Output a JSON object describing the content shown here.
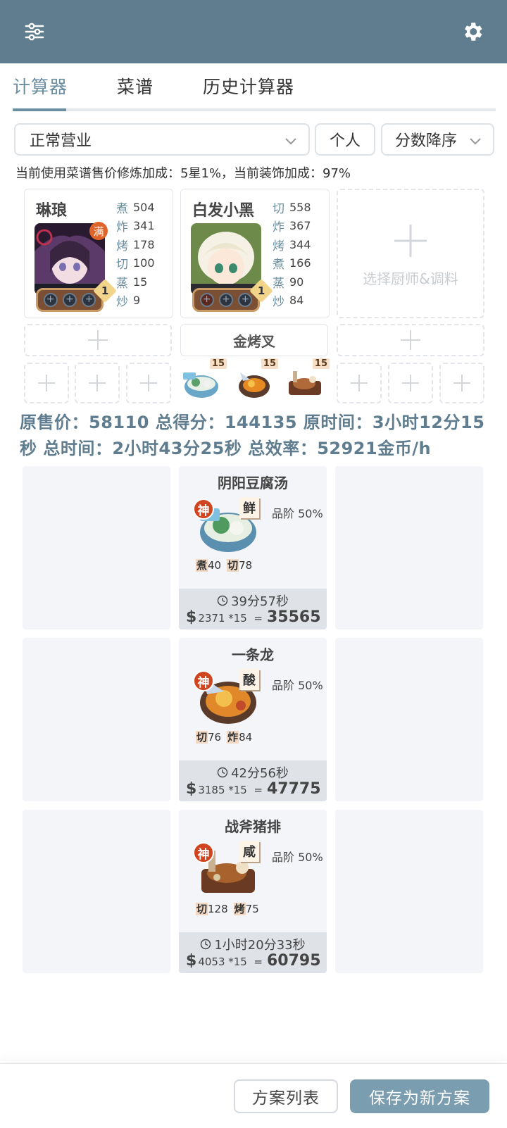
{
  "header": {
    "filter_icon": "sliders-icon",
    "settings_icon": "gear-icon",
    "accent_color": "#5f7d8f"
  },
  "tabs": [
    {
      "label": "计算器",
      "active": true
    },
    {
      "label": "菜谱"
    },
    {
      "label": "历史计算器"
    }
  ],
  "filters": {
    "mode": "正常营业",
    "scope": "个人",
    "sort": "分数降序"
  },
  "info_line": "当前使用菜谱售价修炼加成：5星1%，当前装饰加成：97%",
  "chefs": [
    {
      "name": "琳琅",
      "badge": "满",
      "level": "1",
      "stats": [
        {
          "k": "煮",
          "v": "504"
        },
        {
          "k": "炸",
          "v": "341"
        },
        {
          "k": "烤",
          "v": "178"
        },
        {
          "k": "切",
          "v": "100"
        },
        {
          "k": "蒸",
          "v": "15"
        },
        {
          "k": "炒",
          "v": "9"
        }
      ]
    },
    {
      "name": "白发小黑",
      "level": "1",
      "stats": [
        {
          "k": "切",
          "v": "558"
        },
        {
          "k": "炸",
          "v": "367"
        },
        {
          "k": "烤",
          "v": "344"
        },
        {
          "k": "煮",
          "v": "166"
        },
        {
          "k": "蒸",
          "v": "90"
        },
        {
          "k": "炒",
          "v": "84"
        }
      ]
    }
  ],
  "add_chef_label": "选择厨师&调料",
  "equipment": "金烤叉",
  "mini_recipe_counts": [
    "15",
    "15",
    "15"
  ],
  "summary": "原售价：58110 总得分：144135 原时间：3小时12分15秒 总时间：2小时43分25秒 总效率：52921金币/h",
  "recipes": [
    {
      "name": "阴阳豆腐汤",
      "badge": "神",
      "taste": "鲜",
      "grade": "品阶 50%",
      "req1_k": "煮",
      "req1_v": "40",
      "req2_k": "切",
      "req2_v": "78",
      "time": "39分57秒",
      "price": "2371 *15",
      "total": "35565"
    },
    {
      "name": "一条龙",
      "badge": "神",
      "taste": "酸",
      "grade": "品阶 50%",
      "req1_k": "切",
      "req1_v": "76",
      "req2_k": "炸",
      "req2_v": "84",
      "time": "42分56秒",
      "price": "3185 *15",
      "total": "47775"
    },
    {
      "name": "战斧猪排",
      "badge": "神",
      "taste": "咸",
      "grade": "品阶 50%",
      "req1_k": "切",
      "req1_v": "128",
      "req2_k": "烤",
      "req2_v": "75",
      "time": "1小时20分33秒",
      "price": "4053 *15",
      "total": "60795"
    }
  ],
  "currency_symbol": "$",
  "equals": "=",
  "buttons": {
    "plan_list": "方案列表",
    "save_new": "保存为新方案"
  }
}
